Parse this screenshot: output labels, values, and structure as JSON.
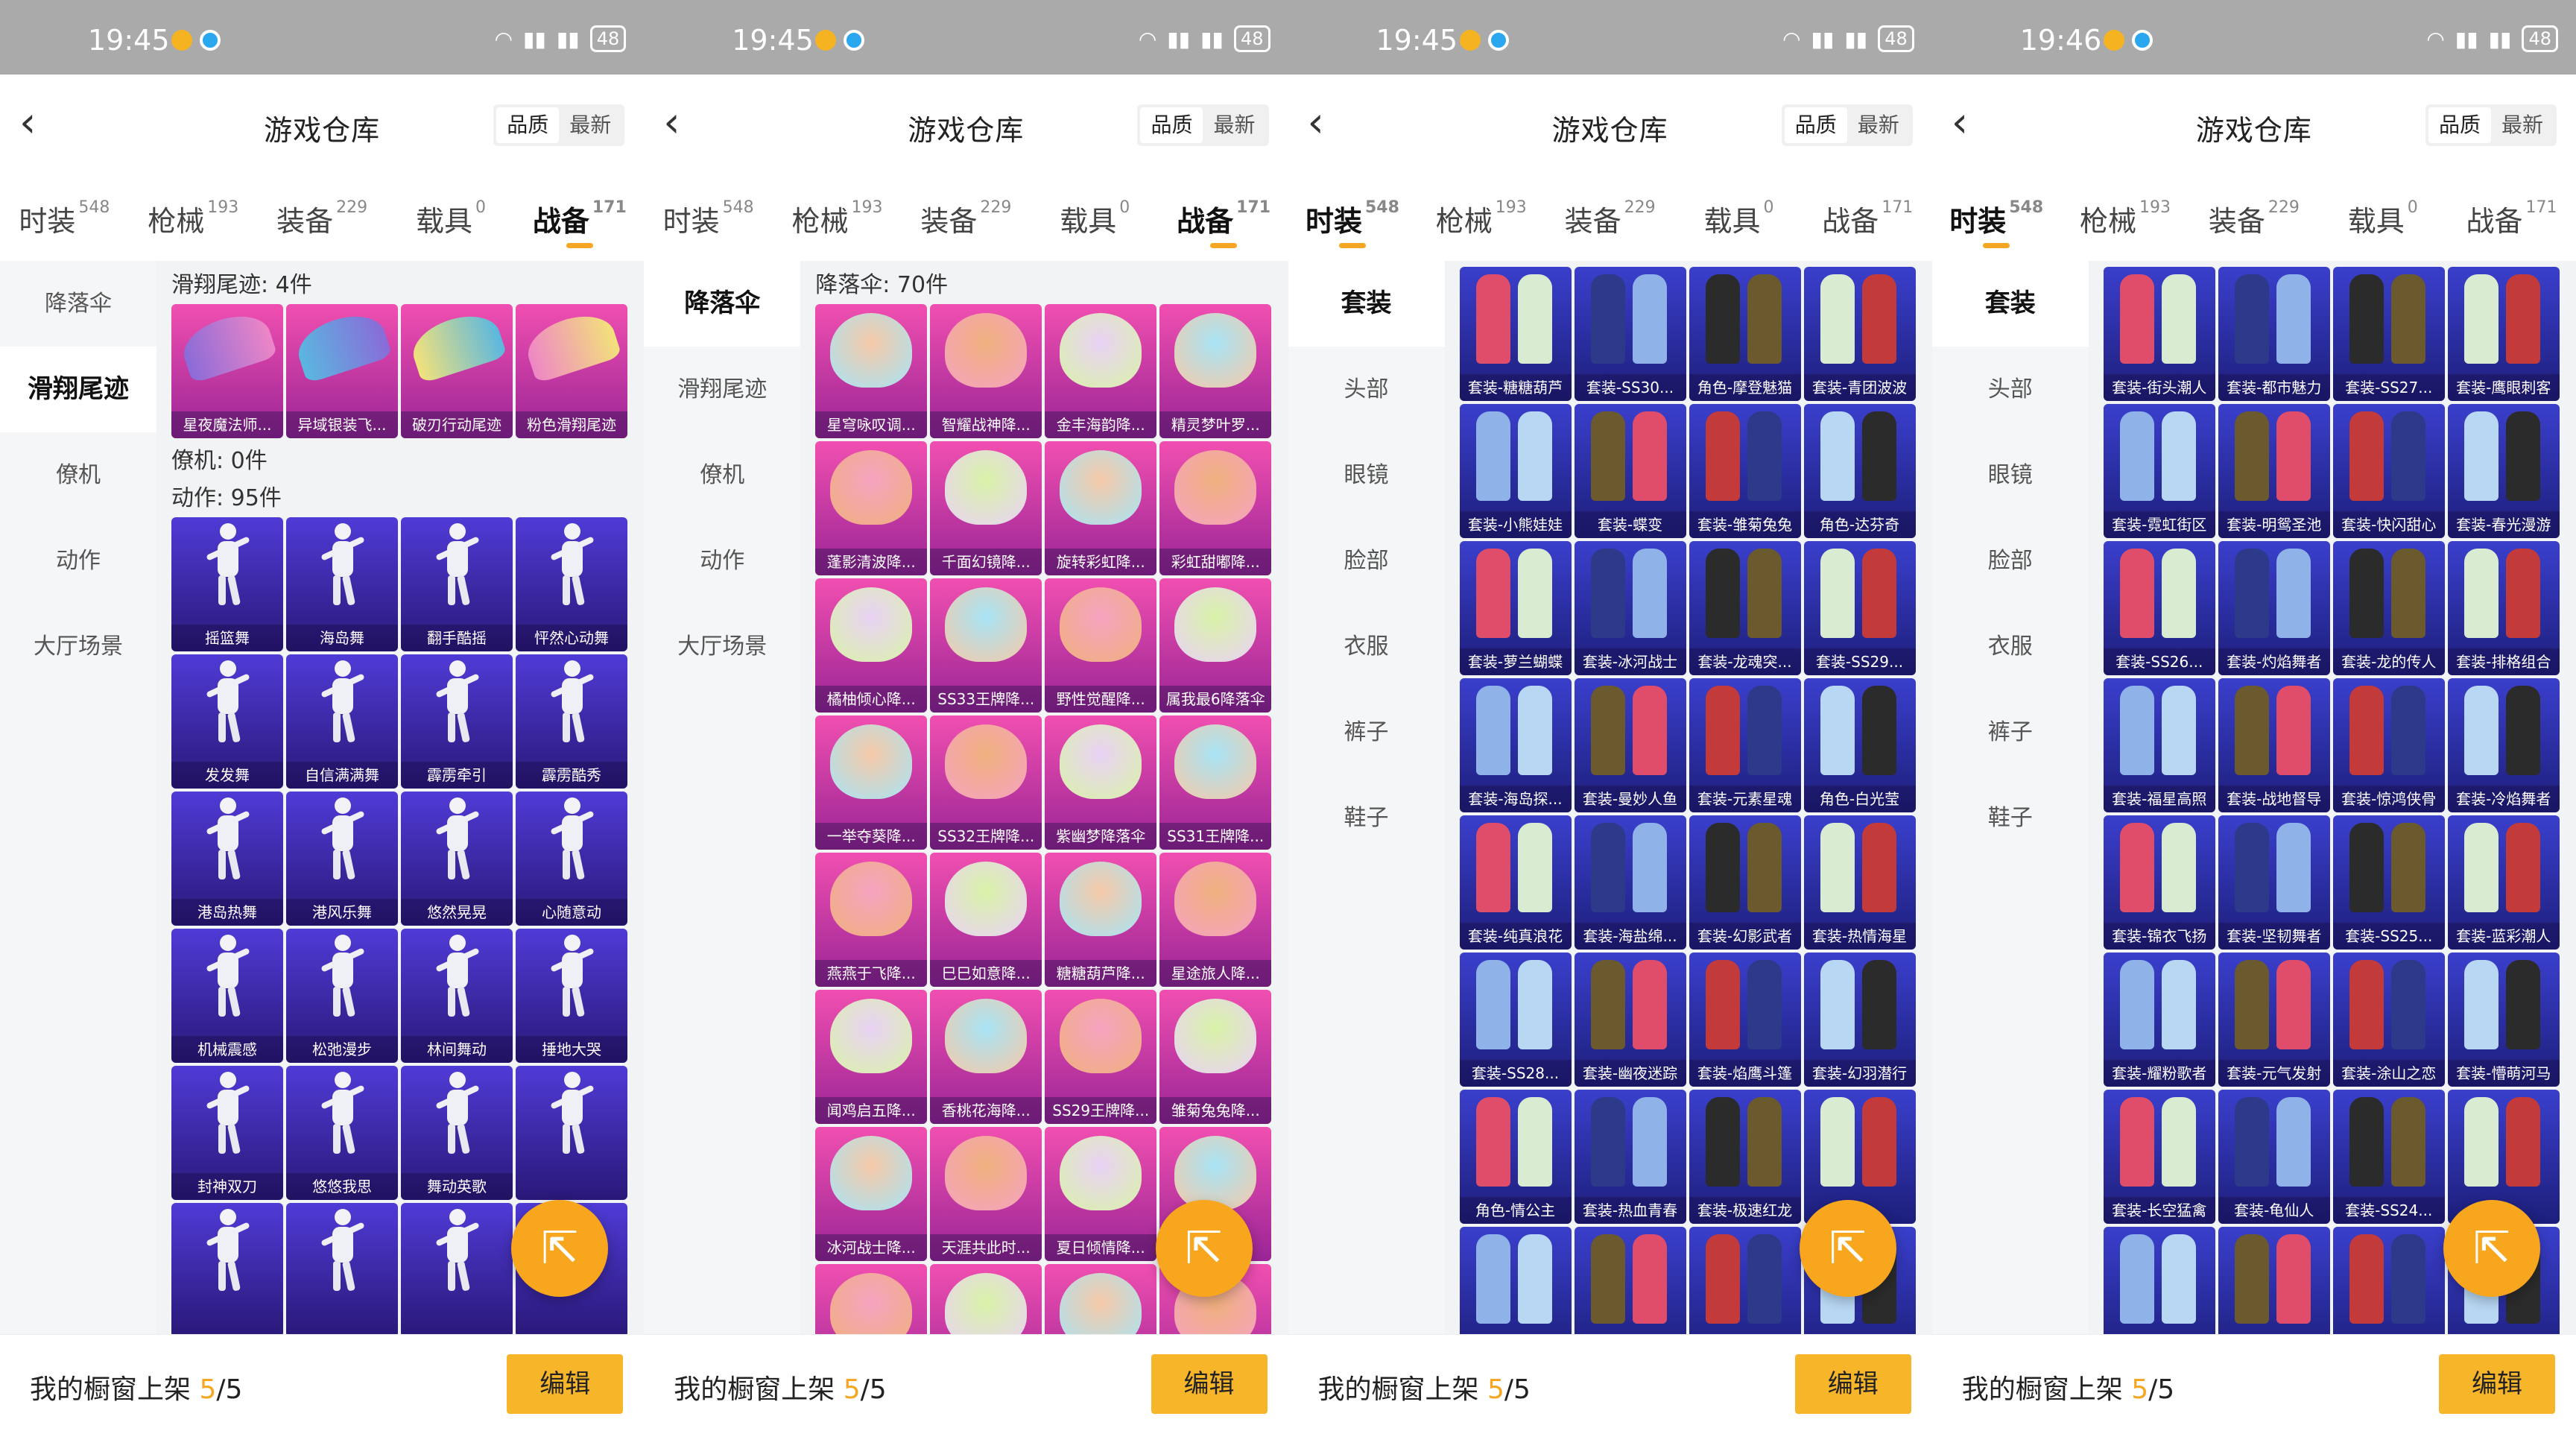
{
  "colors": {
    "accent": "#f5a623",
    "edit_btn": "#f7b52a",
    "fab": "#f7a61e"
  },
  "panels": [
    {
      "status_time": "19:45",
      "title": "游戏仓库",
      "toggle": [
        "品质",
        "最新"
      ],
      "tabs": [
        {
          "label": "时装",
          "count": "548"
        },
        {
          "label": "枪械",
          "count": "193"
        },
        {
          "label": "装备",
          "count": "229"
        },
        {
          "label": "载具",
          "count": "0"
        },
        {
          "label": "战备",
          "count": "171",
          "active": true
        }
      ],
      "side": [
        {
          "label": "降落伞"
        },
        {
          "label": "滑翔尾迹",
          "active": true
        },
        {
          "label": "僚机"
        },
        {
          "label": "动作"
        },
        {
          "label": "大厅场景"
        }
      ],
      "sections": [
        {
          "head": "滑翔尾迹: 4件",
          "style": "q-pink",
          "art": "glider",
          "items": [
            "星夜魔法师...",
            "异域银装飞...",
            "破刃行动尾迹",
            "粉色滑翔尾迹"
          ]
        },
        {
          "head": "僚机: 0件",
          "style": "q-purple",
          "art": "glider",
          "items": []
        },
        {
          "head": "动作: 95件",
          "style": "q-dance",
          "art": "dancer",
          "items": [
            "摇篮舞",
            "海岛舞",
            "翻手酷摇",
            "怦然心动舞",
            "发发舞",
            "自信满满舞",
            "霹雳牵引",
            "霹雳酷秀",
            "港岛热舞",
            "港风乐舞",
            "悠然晃晃",
            "心随意动",
            "机械震感",
            "松弛漫步",
            "林间舞动",
            "捶地大哭",
            "封神双刀",
            "悠悠我思",
            "舞动英歌",
            "",
            "",
            "",
            "",
            ""
          ]
        }
      ],
      "footer": {
        "label": "我的橱窗上架",
        "count": "5",
        "total": "/5",
        "edit": "编辑"
      }
    },
    {
      "status_time": "19:45",
      "title": "游戏仓库",
      "toggle": [
        "品质",
        "最新"
      ],
      "tabs": [
        {
          "label": "时装",
          "count": "548"
        },
        {
          "label": "枪械",
          "count": "193"
        },
        {
          "label": "装备",
          "count": "229"
        },
        {
          "label": "载具",
          "count": "0"
        },
        {
          "label": "战备",
          "count": "171",
          "active": true
        }
      ],
      "side": [
        {
          "label": "降落伞",
          "active": true
        },
        {
          "label": "滑翔尾迹"
        },
        {
          "label": "僚机"
        },
        {
          "label": "动作"
        },
        {
          "label": "大厅场景"
        }
      ],
      "sections": [
        {
          "head": "降落伞: 70件",
          "style": "q-pink",
          "art": "para",
          "items": [
            "星穹咏叹调...",
            "智耀战神降...",
            "金丰海韵降...",
            "精灵梦叶罗...",
            "蓬影清波降...",
            "千面幻镜降...",
            "旋转彩虹降...",
            "彩虹甜嘟降...",
            "橘柚倾心降...",
            "SS33王牌降...",
            "野性觉醒降...",
            "属我最6降落伞",
            "一举夺葵降...",
            "SS32王牌降...",
            "紫幽梦降落伞",
            "SS31王牌降...",
            "燕燕于飞降...",
            "巳巳如意降...",
            "糖糖葫芦降...",
            "星途旅人降...",
            "闻鸡启五降...",
            "香桃花海降...",
            "SS29王牌降...",
            "雏菊兔兔降...",
            "冰河战士降...",
            "天涯共此时...",
            "夏日倾情降...",
            "",
            "",
            "",
            "",
            ""
          ]
        }
      ],
      "footer": {
        "label": "我的橱窗上架",
        "count": "5",
        "total": "/5",
        "edit": "编辑"
      }
    },
    {
      "status_time": "19:45",
      "title": "游戏仓库",
      "toggle": [
        "品质",
        "最新"
      ],
      "tabs": [
        {
          "label": "时装",
          "count": "548",
          "active": true
        },
        {
          "label": "枪械",
          "count": "193"
        },
        {
          "label": "装备",
          "count": "229"
        },
        {
          "label": "载具",
          "count": "0"
        },
        {
          "label": "战备",
          "count": "171"
        }
      ],
      "side": [
        {
          "label": "套装",
          "active": true
        },
        {
          "label": "头部"
        },
        {
          "label": "眼镜"
        },
        {
          "label": "脸部"
        },
        {
          "label": "衣服"
        },
        {
          "label": "裤子"
        },
        {
          "label": "鞋子"
        }
      ],
      "sections": [
        {
          "head": "",
          "style": "q-cloth",
          "art": "outfit",
          "items": [
            "套装-糖糖葫芦",
            "套装-SS30...",
            "角色-摩登魅猫",
            "套装-青团波波",
            "套装-小熊娃娃",
            "套装-蝶变",
            "套装-雏菊兔兔",
            "角色-达芬奇",
            "套装-萝兰蝴蝶",
            "套装-冰河战士",
            "套装-龙魂突...",
            "套装-SS29...",
            "套装-海岛探...",
            "套装-曼妙人鱼",
            "套装-元素星魂",
            "角色-白光莹",
            "套装-纯真浪花",
            "套装-海盐绵...",
            "套装-幻影武者",
            "套装-热情海星",
            "套装-SS28...",
            "套装-幽夜迷踪",
            "套装-焰鹰斗篷",
            "套装-幻羽潜行",
            "角色-情公主",
            "套装-热血青春",
            "套装-极速红龙",
            "",
            "",
            "",
            "",
            ""
          ]
        }
      ],
      "footer": {
        "label": "我的橱窗上架",
        "count": "5",
        "total": "/5",
        "edit": "编辑"
      }
    },
    {
      "status_time": "19:46",
      "title": "游戏仓库",
      "toggle": [
        "品质",
        "最新"
      ],
      "tabs": [
        {
          "label": "时装",
          "count": "548",
          "active": true
        },
        {
          "label": "枪械",
          "count": "193"
        },
        {
          "label": "装备",
          "count": "229"
        },
        {
          "label": "载具",
          "count": "0"
        },
        {
          "label": "战备",
          "count": "171"
        }
      ],
      "side": [
        {
          "label": "套装",
          "active": true
        },
        {
          "label": "头部"
        },
        {
          "label": "眼镜"
        },
        {
          "label": "脸部"
        },
        {
          "label": "衣服"
        },
        {
          "label": "裤子"
        },
        {
          "label": "鞋子"
        }
      ],
      "sections": [
        {
          "head": "",
          "style": "q-cloth",
          "art": "outfit",
          "items": [
            "套装-街头潮人",
            "套装-都市魅力",
            "套装-SS27...",
            "套装-鹰眼刺客",
            "套装-霓虹街区",
            "套装-明鸳圣池",
            "套装-快闪甜心",
            "套装-春光漫游",
            "套装-SS26...",
            "套装-灼焰舞者",
            "套装-龙的传人",
            "套装-排格组合",
            "套装-福星高照",
            "套装-战地督导",
            "套装-惊鸿侠骨",
            "套装-冷焰舞者",
            "套装-锦衣飞扬",
            "套装-坚韧舞者",
            "套装-SS25...",
            "套装-蓝彩潮人",
            "套装-耀粉歌者",
            "套装-元气发射",
            "套装-涂山之恋",
            "套装-懵萌河马",
            "套装-长空猛禽",
            "套装-龟仙人",
            "套装-SS24...",
            "",
            "",
            "",
            "",
            ""
          ]
        }
      ],
      "footer": {
        "label": "我的橱窗上架",
        "count": "5",
        "total": "/5",
        "edit": "编辑"
      }
    }
  ]
}
